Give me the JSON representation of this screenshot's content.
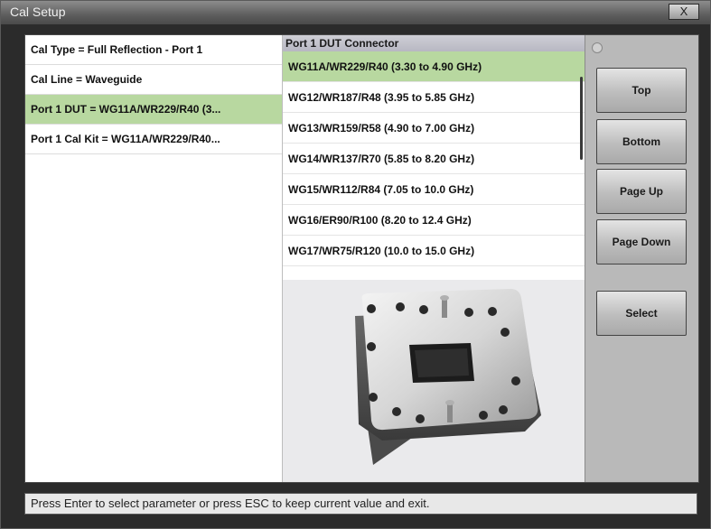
{
  "window": {
    "title": "Cal Setup",
    "close_label": "X"
  },
  "parameters": [
    {
      "label": "Cal Type = Full Reflection - Port 1",
      "selected": false
    },
    {
      "label": "Cal Line = Waveguide",
      "selected": false
    },
    {
      "label": "Port 1 DUT = WG11A/WR229/R40 (3...",
      "selected": true
    },
    {
      "label": "Port 1 Cal Kit = WG11A/WR229/R40...",
      "selected": false
    }
  ],
  "connector_list": {
    "header": "Port 1 DUT Connector",
    "items": [
      {
        "label": "WG11A/WR229/R40 (3.30 to 4.90 GHz)",
        "selected": true
      },
      {
        "label": "WG12/WR187/R48 (3.95 to 5.85 GHz)",
        "selected": false
      },
      {
        "label": "WG13/WR159/R58 (4.90 to 7.00 GHz)",
        "selected": false
      },
      {
        "label": "WG14/WR137/R70 (5.85 to 8.20 GHz)",
        "selected": false
      },
      {
        "label": "WG15/WR112/R84 (7.05 to 10.0 GHz)",
        "selected": false
      },
      {
        "label": "WG16/ER90/R100 (8.20 to 12.4 GHz)",
        "selected": false
      },
      {
        "label": "WG17/WR75/R120 (10.0 to 15.0 GHz)",
        "selected": false
      }
    ]
  },
  "buttons": {
    "top": "Top",
    "bottom": "Bottom",
    "page_up": "Page Up",
    "page_down": "Page Down",
    "select": "Select"
  },
  "status": "Press Enter to select parameter or press ESC to keep current value and exit.",
  "colors": {
    "selection": "#b8d8a0",
    "header": "#c4c4cc"
  }
}
